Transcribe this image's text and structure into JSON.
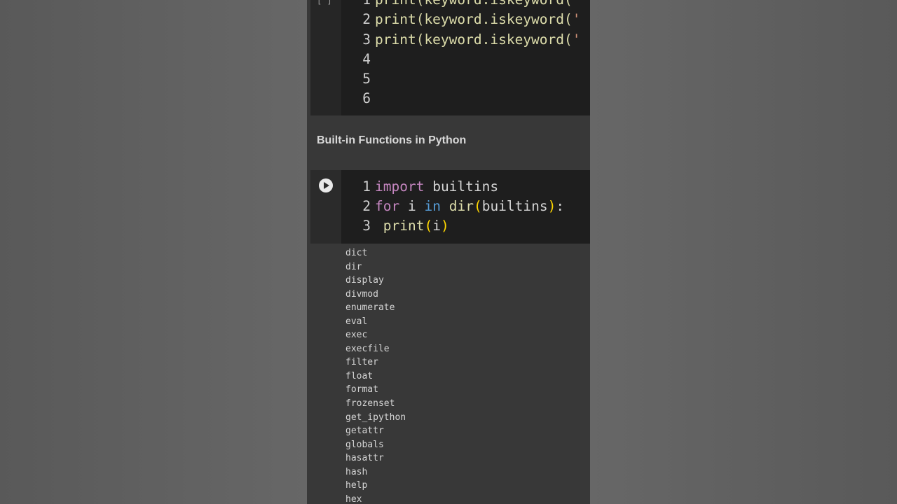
{
  "cell1": {
    "run_indicator": "[ ]",
    "lines": [
      {
        "num": "1",
        "pre": "print(keyword.iskeyword(",
        "post": "'"
      },
      {
        "num": "2",
        "pre": "print(keyword.iskeyword(",
        "post": "'"
      },
      {
        "num": "3",
        "pre": "print(keyword.iskeyword(",
        "post": "'"
      },
      {
        "num": "4"
      },
      {
        "num": "5"
      },
      {
        "num": "6"
      }
    ]
  },
  "heading": "Built-in Functions in Python",
  "cell2": {
    "lines": [
      {
        "num": "1",
        "kw": "import",
        "text": "builtins"
      },
      {
        "num": "2",
        "kw": "for",
        "var": "i",
        "kw_in": "in",
        "fn": "dir",
        "arg": "builtins",
        "tail": ":"
      },
      {
        "num": "3",
        "fn": "print",
        "arg": "i"
      }
    ]
  },
  "output": [
    "dict",
    "dir",
    "display",
    "divmod",
    "enumerate",
    "eval",
    "exec",
    "execfile",
    "filter",
    "float",
    "format",
    "frozenset",
    "get_ipython",
    "getattr",
    "globals",
    "hasattr",
    "hash",
    "help",
    "hex"
  ],
  "colors": {
    "keyword": "#c586c0",
    "keyword_in": "#569cd6",
    "function": "#dcdcaa",
    "bracket": "#ffd700",
    "string": "#ce9178"
  }
}
